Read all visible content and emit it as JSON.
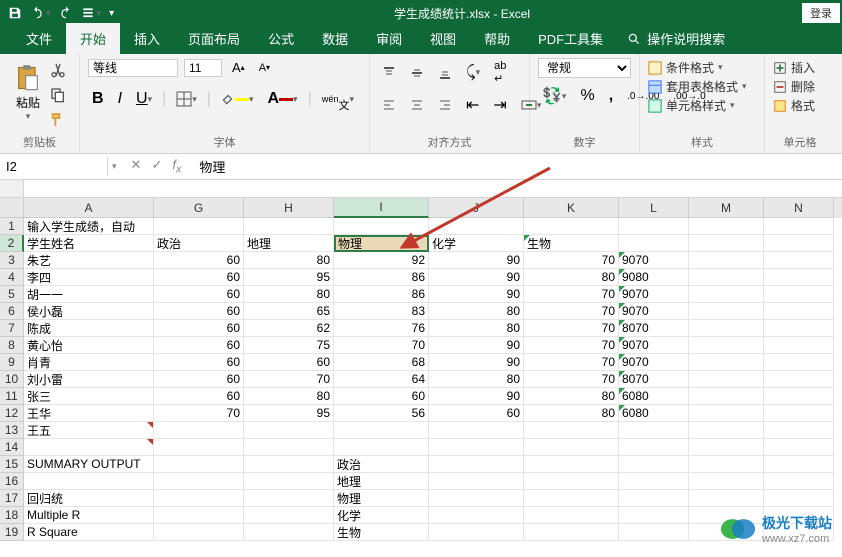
{
  "title": "学生成绩统计.xlsx - Excel",
  "login": "登录",
  "tabs": [
    "文件",
    "开始",
    "插入",
    "页面布局",
    "公式",
    "数据",
    "审阅",
    "视图",
    "帮助",
    "PDF工具集"
  ],
  "activeTab": 1,
  "searchHint": "操作说明搜索",
  "ribbon": {
    "clipboard": {
      "label": "剪贴板",
      "paste": "粘贴"
    },
    "font": {
      "label": "字体",
      "name": "等线",
      "size": "11"
    },
    "alignment": {
      "label": "对齐方式"
    },
    "number": {
      "label": "数字",
      "format": "常规"
    },
    "styles": {
      "label": "样式",
      "cond": "条件格式",
      "table": "套用表格格式",
      "cell": "单元格样式"
    },
    "cells": {
      "label": "单元格",
      "insert": "插入",
      "delete": "删除",
      "format": "格式"
    }
  },
  "formulaBar": {
    "nameBox": "I2",
    "value": "物理"
  },
  "columns": [
    "A",
    "G",
    "H",
    "I",
    "J",
    "K",
    "L",
    "M",
    "N"
  ],
  "selectedCol": 3,
  "selectedRow": 1,
  "selectedCell": {
    "r": 1,
    "c": 3
  },
  "gridRows": [
    {
      "h": "1",
      "cells": [
        "输入学生成绩，自动",
        "",
        "",
        "",
        "",
        "",
        "",
        "",
        ""
      ]
    },
    {
      "h": "2",
      "cells": [
        "学生姓名",
        "政治",
        "地理",
        "物理",
        "化学",
        "生物",
        "",
        "",
        ""
      ]
    },
    {
      "h": "3",
      "cells": [
        "朱艺",
        "60",
        "80",
        "92",
        "90",
        "70",
        "9070",
        "",
        ""
      ]
    },
    {
      "h": "4",
      "cells": [
        "李四",
        "60",
        "95",
        "86",
        "90",
        "80",
        "9080",
        "",
        ""
      ]
    },
    {
      "h": "5",
      "cells": [
        "胡一一",
        "60",
        "80",
        "86",
        "90",
        "70",
        "9070",
        "",
        ""
      ]
    },
    {
      "h": "6",
      "cells": [
        "侯小磊",
        "60",
        "65",
        "83",
        "80",
        "70",
        "9070",
        "",
        ""
      ]
    },
    {
      "h": "7",
      "cells": [
        "陈成",
        "60",
        "62",
        "76",
        "80",
        "70",
        "8070",
        "",
        ""
      ]
    },
    {
      "h": "8",
      "cells": [
        "黄心怡",
        "60",
        "75",
        "70",
        "90",
        "70",
        "9070",
        "",
        ""
      ]
    },
    {
      "h": "9",
      "cells": [
        "肖青",
        "60",
        "60",
        "68",
        "90",
        "70",
        "9070",
        "",
        ""
      ]
    },
    {
      "h": "10",
      "cells": [
        "刘小雷",
        "60",
        "70",
        "64",
        "80",
        "70",
        "8070",
        "",
        ""
      ]
    },
    {
      "h": "11",
      "cells": [
        "张三",
        "60",
        "80",
        "60",
        "90",
        "80",
        "6080",
        "",
        ""
      ]
    },
    {
      "h": "12",
      "cells": [
        "王华",
        "70",
        "95",
        "56",
        "60",
        "80",
        "6080",
        "",
        ""
      ]
    },
    {
      "h": "13",
      "cells": [
        "王五",
        "",
        "",
        "",
        "",
        "",
        "",
        "",
        ""
      ]
    },
    {
      "h": "14",
      "cells": [
        "",
        "",
        "",
        "",
        "",
        "",
        "",
        "",
        ""
      ]
    },
    {
      "h": "15",
      "cells": [
        "SUMMARY OUTPUT",
        "",
        "",
        "政治",
        "",
        "",
        "",
        "",
        ""
      ]
    },
    {
      "h": "16",
      "cells": [
        "",
        "",
        "",
        "地理",
        "",
        "",
        "",
        "",
        ""
      ]
    },
    {
      "h": "17",
      "cells": [
        "回归统",
        "",
        "",
        "物理",
        "",
        "",
        "",
        "",
        ""
      ]
    },
    {
      "h": "18",
      "cells": [
        "Multiple R",
        "",
        "",
        "化学",
        "",
        "",
        "",
        "",
        ""
      ]
    },
    {
      "h": "19",
      "cells": [
        "R Square",
        "",
        "",
        "生物",
        "",
        "",
        "",
        "",
        ""
      ]
    }
  ],
  "redMarks": [
    [
      12,
      0
    ],
    [
      13,
      0
    ]
  ],
  "greenMarks": [
    [
      2,
      6
    ],
    [
      3,
      6
    ],
    [
      4,
      6
    ],
    [
      5,
      6
    ],
    [
      6,
      6
    ],
    [
      7,
      6
    ],
    [
      8,
      6
    ],
    [
      9,
      6
    ],
    [
      10,
      6
    ],
    [
      11,
      6
    ],
    [
      1,
      5
    ]
  ],
  "watermark": {
    "name": "极光下载站",
    "url": "www.xz7.com"
  }
}
